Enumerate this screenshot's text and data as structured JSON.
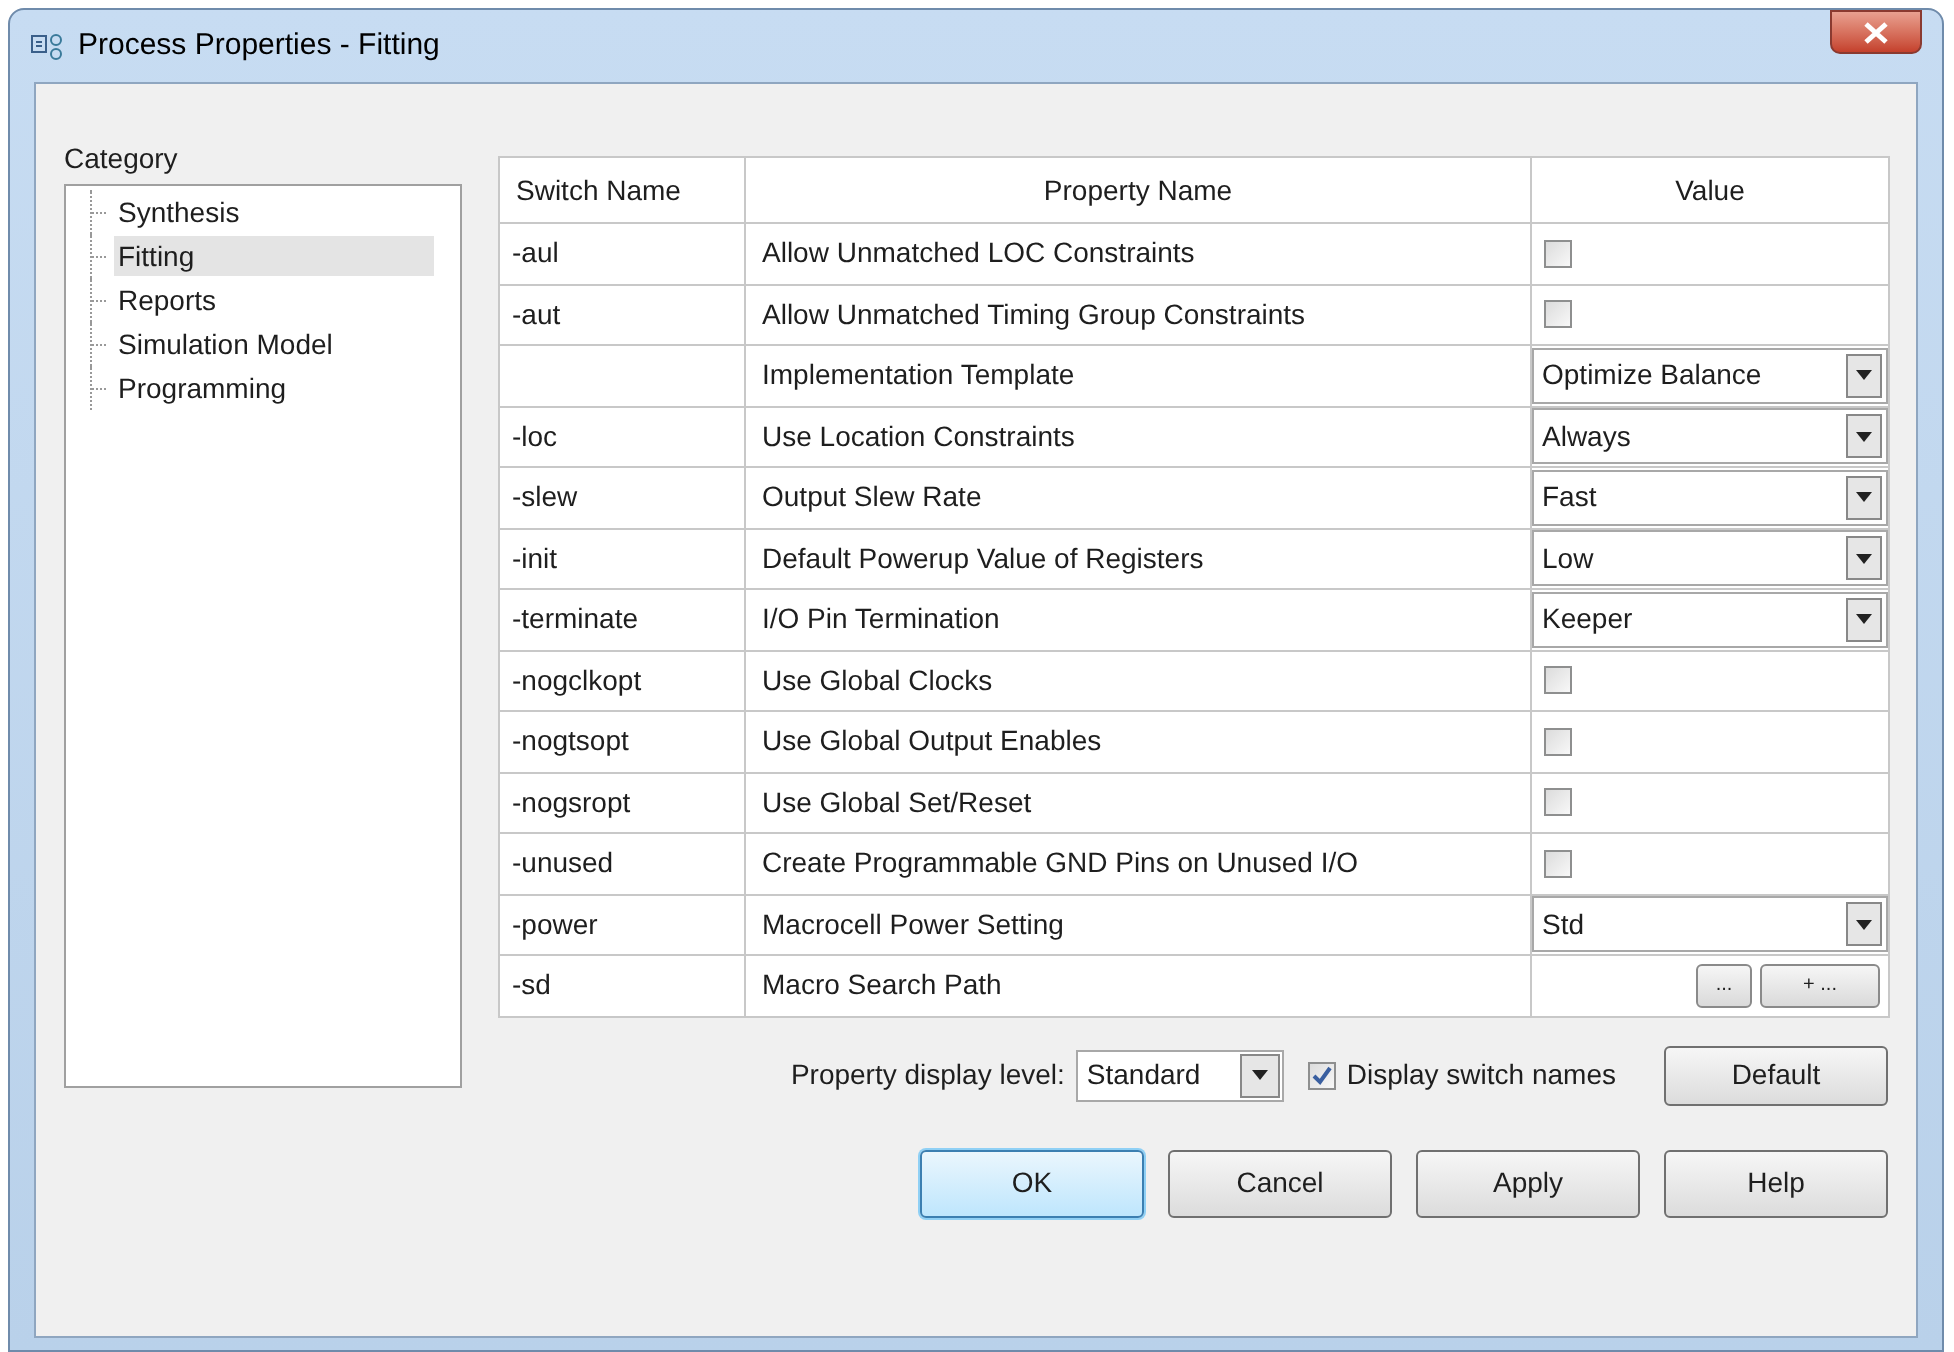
{
  "window": {
    "title": "Process Properties - Fitting"
  },
  "category": {
    "label": "Category",
    "items": [
      {
        "label": "Synthesis",
        "selected": false
      },
      {
        "label": "Fitting",
        "selected": true
      },
      {
        "label": "Reports",
        "selected": false
      },
      {
        "label": "Simulation Model",
        "selected": false
      },
      {
        "label": "Programming",
        "selected": false
      }
    ]
  },
  "table": {
    "columns": [
      "Switch Name",
      "Property Name",
      "Value"
    ],
    "rows": [
      {
        "switch": "-aul",
        "property": "Allow Unmatched LOC Constraints",
        "value": {
          "kind": "checkbox",
          "checked": false
        }
      },
      {
        "switch": "-aut",
        "property": "Allow Unmatched Timing Group Constraints",
        "value": {
          "kind": "checkbox",
          "checked": false
        }
      },
      {
        "switch": "",
        "property": "Implementation Template",
        "value": {
          "kind": "dropdown",
          "text": "Optimize Balance"
        }
      },
      {
        "switch": "-loc",
        "property": "Use Location Constraints",
        "value": {
          "kind": "dropdown",
          "text": "Always"
        }
      },
      {
        "switch": "-slew",
        "property": "Output Slew Rate",
        "value": {
          "kind": "dropdown",
          "text": "Fast"
        }
      },
      {
        "switch": "-init",
        "property": "Default Powerup Value of Registers",
        "value": {
          "kind": "dropdown",
          "text": "Low"
        }
      },
      {
        "switch": "-terminate",
        "property": "I/O Pin Termination",
        "value": {
          "kind": "dropdown",
          "text": "Keeper"
        }
      },
      {
        "switch": "-nogclkopt",
        "property": "Use Global Clocks",
        "value": {
          "kind": "checkbox",
          "checked": false
        }
      },
      {
        "switch": "-nogtsopt",
        "property": "Use Global Output Enables",
        "value": {
          "kind": "checkbox",
          "checked": false
        }
      },
      {
        "switch": "-nogsropt",
        "property": "Use Global Set/Reset",
        "value": {
          "kind": "checkbox",
          "checked": false
        }
      },
      {
        "switch": "-unused",
        "property": "Create Programmable GND Pins on Unused I/O",
        "value": {
          "kind": "checkbox",
          "checked": false
        }
      },
      {
        "switch": "-power",
        "property": "Macrocell Power Setting",
        "value": {
          "kind": "dropdown",
          "text": "Std"
        }
      },
      {
        "switch": "-sd",
        "property": "Macro Search Path",
        "value": {
          "kind": "path",
          "buttons": [
            "...",
            "+ ..."
          ]
        }
      }
    ]
  },
  "display_level": {
    "label": "Property display level:",
    "value": "Standard"
  },
  "display_switch_names": {
    "label": "Display switch names",
    "checked": true
  },
  "default_button": "Default",
  "buttons": [
    {
      "label": "OK",
      "selected": true
    },
    {
      "label": "Cancel",
      "selected": false
    },
    {
      "label": "Apply",
      "selected": false
    },
    {
      "label": "Help",
      "selected": false
    }
  ]
}
